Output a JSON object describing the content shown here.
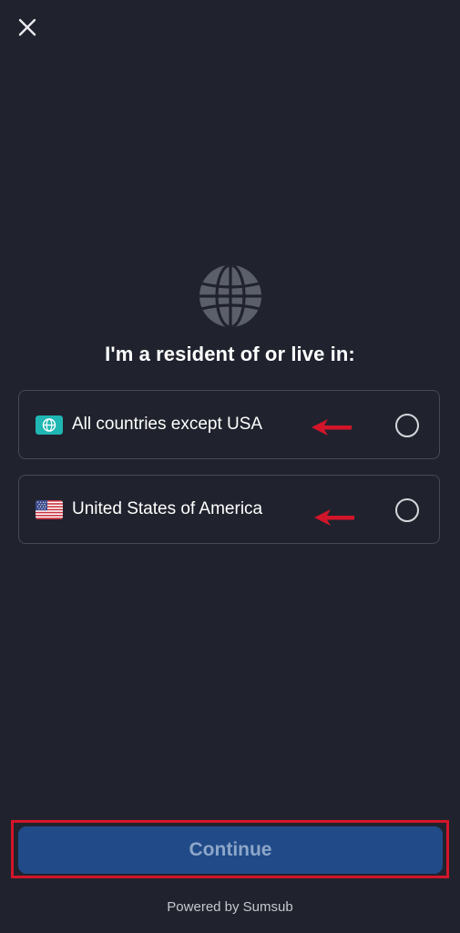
{
  "heading": "I'm a resident of or live in:",
  "options": [
    {
      "label": "All countries except USA",
      "icon": "globe-badge-icon",
      "selected": false
    },
    {
      "label": "United States of America",
      "icon": "us-flag-icon",
      "selected": false
    }
  ],
  "continue_label": "Continue",
  "footer": "Powered by Sumsub",
  "colors": {
    "background": "#20232d",
    "button": "#204b88",
    "button_text": "#8ea6c9",
    "annotation": "#d3152a",
    "globe_badge": "#1fb7b3"
  },
  "icons": {
    "close": "close-icon",
    "globe": "globe-icon",
    "annotation_arrow": "arrow-left-icon"
  }
}
